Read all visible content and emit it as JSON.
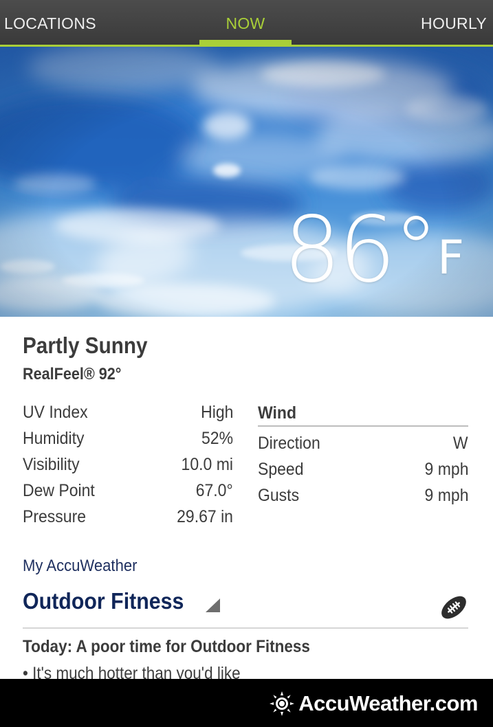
{
  "tabs": {
    "locations": "LOCATIONS",
    "now": "NOW",
    "hourly": "HOURLY",
    "active": "now"
  },
  "current": {
    "temperature": "86°",
    "unit": "F",
    "condition": "Partly Sunny",
    "realfeel": "RealFeel® 92°"
  },
  "details": [
    {
      "label": "UV Index",
      "value": "High"
    },
    {
      "label": "Humidity",
      "value": "52%"
    },
    {
      "label": "Visibility",
      "value": "10.0 mi"
    },
    {
      "label": "Dew Point",
      "value": "67.0°"
    },
    {
      "label": "Pressure",
      "value": "29.67 in"
    }
  ],
  "wind": {
    "title": "Wind",
    "rows": [
      {
        "label": "Direction",
        "value": "W"
      },
      {
        "label": "Speed",
        "value": "9 mph"
      },
      {
        "label": "Gusts",
        "value": "9 mph"
      }
    ]
  },
  "my_accuweather": {
    "label": "My AccuWeather",
    "activity": "Outdoor Fitness",
    "activity_icon": "football-icon",
    "forecast_title": "Today: A poor time for Outdoor Fitness",
    "forecast_bullet": "• It's much hotter than you'd like"
  },
  "footer": {
    "brand": "AccuWeather.com",
    "logo_icon": "sun-icon"
  },
  "colors": {
    "accent": "#a9cf38",
    "tabbar": "#454545",
    "text": "#3c3c3c",
    "navy": "#102659",
    "footer": "#000000"
  }
}
